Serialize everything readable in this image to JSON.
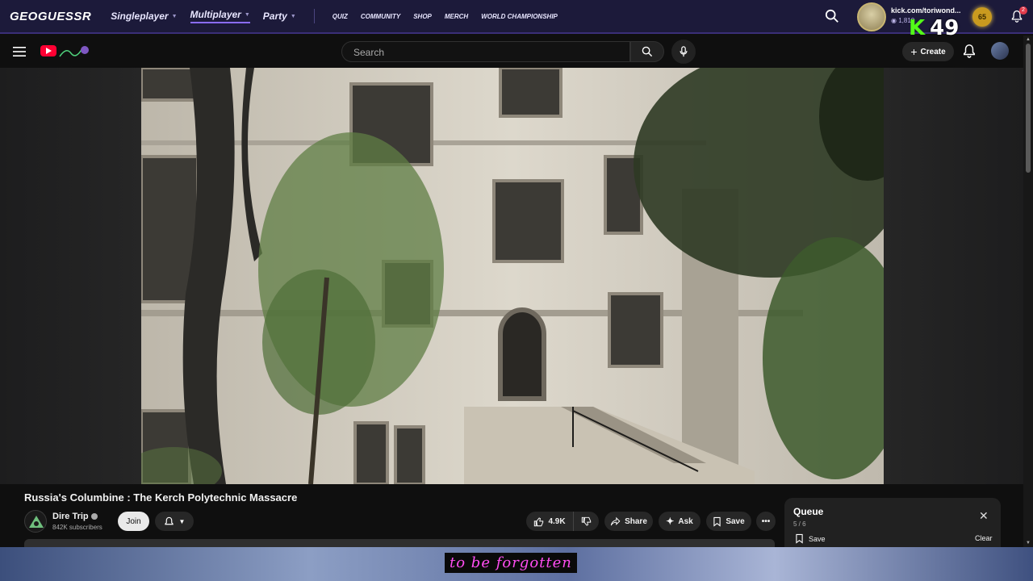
{
  "geoguessr": {
    "logo": "GEOGUESSR",
    "nav": [
      {
        "label": "Singleplayer",
        "active": false
      },
      {
        "label": "Multiplayer",
        "active": true
      },
      {
        "label": "Party",
        "active": false
      }
    ],
    "small_nav": [
      "QUIZ",
      "COMMUNITY",
      "SHOP",
      "MERCH",
      "WORLD CHAMPIONSHIP"
    ],
    "username": "kick.com/toriwond...",
    "coins": "1,810",
    "level": "65",
    "notification_count": "2",
    "kick_label": "K",
    "kick_viewers": "49",
    "accent_color": "#8a6cff"
  },
  "youtube": {
    "search_placeholder": "Search",
    "create_label": "Create"
  },
  "video": {
    "title": "Russia's Columbine : The Kerch Polytechnic Massacre",
    "channel": "Dire Trip",
    "subscribers": "842K subscribers",
    "join_label": "Join",
    "likes": "4.9K",
    "share_label": "Share",
    "ask_label": "Ask",
    "save_label": "Save",
    "caption": "to be forgotten"
  },
  "queue": {
    "title": "Queue",
    "position": "5 / 6",
    "save_label": "Save",
    "clear_label": "Clear"
  }
}
